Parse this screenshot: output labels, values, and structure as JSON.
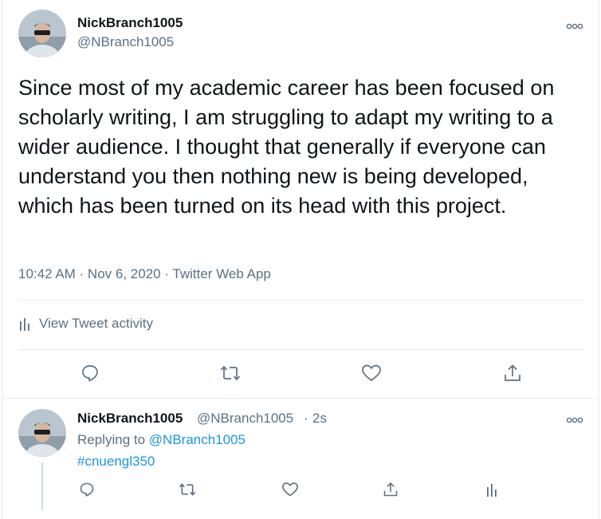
{
  "main_tweet": {
    "display_name": "NickBranch1005",
    "handle": "@NBranch1005",
    "text": "Since most of my academic career has been focused on scholarly writing, I am struggling to adapt my writing to a wider audience. I thought that generally if everyone can understand you then nothing new is being developed, which has been turned on its head with this project.",
    "timestamp": "10:42 AM · Nov 6, 2020 · Twitter Web App",
    "activity_label": "View Tweet activity"
  },
  "reply_tweet": {
    "display_name": "NickBranch1005",
    "handle": "@NBranch1005",
    "separator": "·",
    "age": "2s",
    "replying_prefix": "Replying to",
    "replying_to": "@NBranch1005",
    "hashtag": "#cnuengl350"
  },
  "colors": {
    "text": "#0f1419",
    "secondary": "#5b7083",
    "link": "#1b95e0",
    "divider": "#e6ecf0"
  },
  "icons": [
    "reply-icon",
    "retweet-icon",
    "like-icon",
    "share-icon",
    "analytics-icon",
    "more-icon"
  ]
}
